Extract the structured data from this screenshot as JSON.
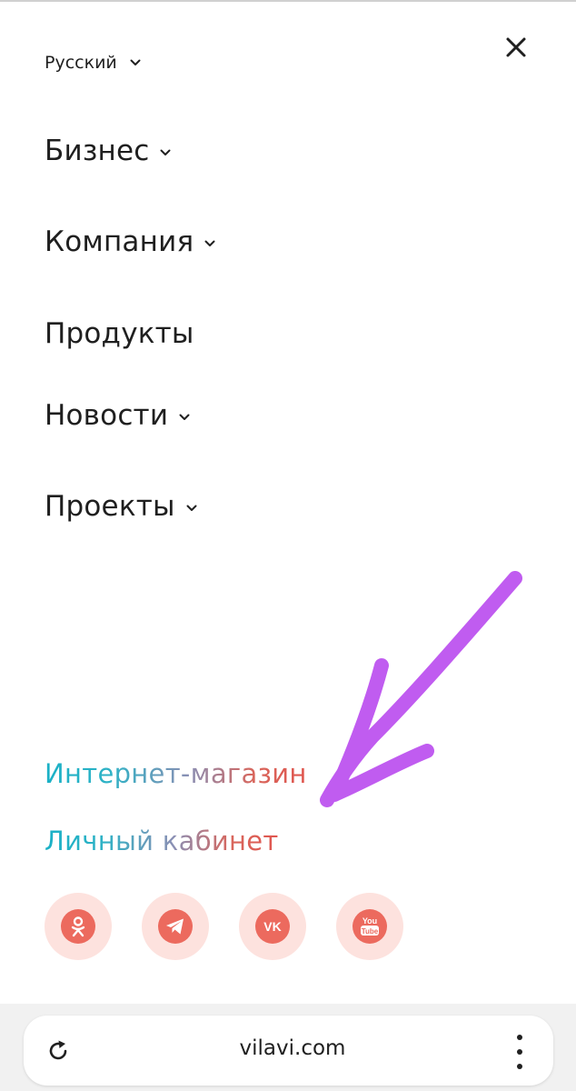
{
  "language": {
    "selected": "Русский",
    "icon": "chevron-down-icon"
  },
  "menu": {
    "close_icon": "close-icon",
    "items": [
      {
        "label": "Бизнес",
        "has_submenu": true
      },
      {
        "label": "Компания",
        "has_submenu": true
      },
      {
        "label": "Продукты",
        "has_submenu": false
      },
      {
        "label": "Новости",
        "has_submenu": true
      },
      {
        "label": "Проекты",
        "has_submenu": true
      }
    ]
  },
  "links": {
    "shop": "Интернет-магазин",
    "account": "Личный кабинет"
  },
  "social": [
    {
      "icon": "odnoklassniki-icon"
    },
    {
      "icon": "telegram-icon"
    },
    {
      "icon": "vk-icon",
      "text": "VK"
    },
    {
      "icon": "youtube-icon",
      "text_top": "You",
      "text_bottom": "Tube"
    }
  ],
  "browser": {
    "url": "vilavi.com",
    "reload_icon": "reload-icon",
    "menu_icon": "more-vertical-icon"
  },
  "colors": {
    "text": "#1f1f1f",
    "gradient_start": "#1ab1c6",
    "gradient_end": "#e0564f",
    "social_bg": "#fde2de",
    "social_icon": "#ec6a5e",
    "annotation_arrow": "#c05cf0"
  }
}
